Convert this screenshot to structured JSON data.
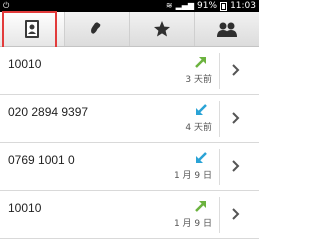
{
  "status_bar": {
    "battery": "91%",
    "time": "11:03",
    "icons": [
      "usb-icon",
      "wifi-icon",
      "signal-icon",
      "battery-icon"
    ]
  },
  "tabs": [
    {
      "name": "contacts",
      "icon": "contacts-book-icon",
      "active": true
    },
    {
      "name": "call-log",
      "icon": "phone-handset-icon",
      "active": false
    },
    {
      "name": "favorites",
      "icon": "star-icon",
      "active": false
    },
    {
      "name": "groups",
      "icon": "people-icon",
      "active": false
    }
  ],
  "annotation": {
    "color": "#e23b3b"
  },
  "calls": [
    {
      "number": "10010",
      "date": "3 天前",
      "type": "outgoing",
      "type_color": "#6cb33f"
    },
    {
      "number": "020 2894 9397",
      "date": "4 天前",
      "type": "incoming",
      "type_color": "#2aa3d6"
    },
    {
      "number": "0769 1001 0",
      "date": "1 月 9 日",
      "type": "incoming",
      "type_color": "#2aa3d6"
    },
    {
      "number": "10010",
      "date": "1 月 9 日",
      "type": "outgoing",
      "type_color": "#6cb33f"
    }
  ]
}
